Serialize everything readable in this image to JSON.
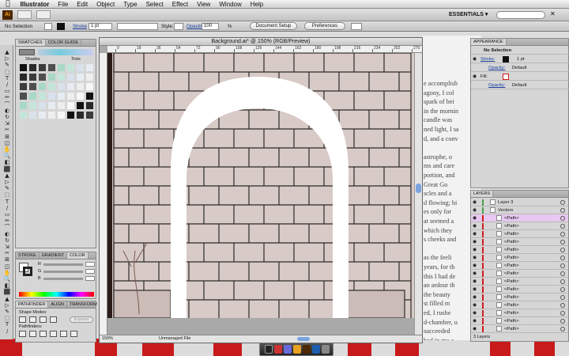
{
  "menubar": {
    "apple": "",
    "app": "Illustrator",
    "items": [
      "File",
      "Edit",
      "Object",
      "Type",
      "Select",
      "Effect",
      "View",
      "Window",
      "Help"
    ]
  },
  "appbar": {
    "logo": "Ai",
    "workspace": "ESSENTIALS ▾"
  },
  "control": {
    "selection": "No Selection",
    "stroke_label": "Stroke",
    "stroke_value": "1 pt",
    "style_label": "Style:",
    "opacity_label": "Opacity:",
    "opacity_value": "100",
    "opacity_unit": "%",
    "doc_setup": "Document Setup",
    "preferences": "Preferences"
  },
  "swatches": {
    "tabs": [
      "SWATCHES",
      "COLOR GUIDE"
    ],
    "shades_label": "Shades",
    "tints_label": "Tints"
  },
  "color": {
    "tabs": [
      "STROKE",
      "GRADIENT",
      "COLOR"
    ],
    "r": "R",
    "g": "G",
    "b": "B"
  },
  "pathfinder": {
    "tabs": [
      "PATHFINDER",
      "ALIGN",
      "TRANSFORM"
    ],
    "shape_modes": "Shape Modes:",
    "pathfinders": "Pathfinders:",
    "expand": "Expand"
  },
  "document": {
    "title": "Background.ai* @ 150% (RGB/Preview)",
    "ruler": [
      "0",
      "18",
      "36",
      "54",
      "72",
      "90",
      "108",
      "126",
      "144",
      "162",
      "180",
      "198",
      "216",
      "234",
      "252",
      "270"
    ],
    "zoom": "150%",
    "status": "Unmanaged File"
  },
  "appearance": {
    "tab": "APPEARANCE",
    "header": "No Selection",
    "stroke_label": "Stroke:",
    "stroke_value": "1 pt",
    "opacity_label": "Opacity:",
    "opacity_value": "Default",
    "fill_label": "Fill:",
    "opacity2_label": "Opacity:",
    "opacity2_value": "Default"
  },
  "layers": {
    "tab": "LAYERS",
    "rows": [
      "Layer 3",
      "Vectors",
      "<Path>",
      "<Path>",
      "<Path>",
      "<Path>",
      "<Path>",
      "<Path>",
      "<Path>",
      "<Path>",
      "<Path>",
      "<Path>",
      "<Path>",
      "<Path>",
      "<Path>",
      "<Path>",
      "<Path>"
    ],
    "footer": "3 Layers"
  },
  "text_behind": [
    "e accomplish",
    "agony, I col",
    "spark of bei",
    "in the mornin",
    "candle was",
    "ned light, I sa",
    "d, and a conv",
    "",
    "astrophe, o",
    "ms and care",
    "portion, and",
    "Great Go",
    "scles and a",
    "d flowing; hi",
    "es only for",
    "at seemed a",
    "which they",
    "s cheeks and",
    "",
    "as the feeli",
    "years, for th",
    "this I had de",
    "an ardour th",
    "the beauty",
    "st filled m",
    "ed, I rushe",
    "d-chamber, u",
    "succeeded",
    "bed in my c",
    "But it was i",
    "ms."
  ],
  "colors": {
    "arch": "#ffffff",
    "wall": "#d8cac6",
    "brick_line": "#2b2b2b",
    "layer_highlight": "#e8c8f0",
    "selection_red": "#d11b1b"
  }
}
